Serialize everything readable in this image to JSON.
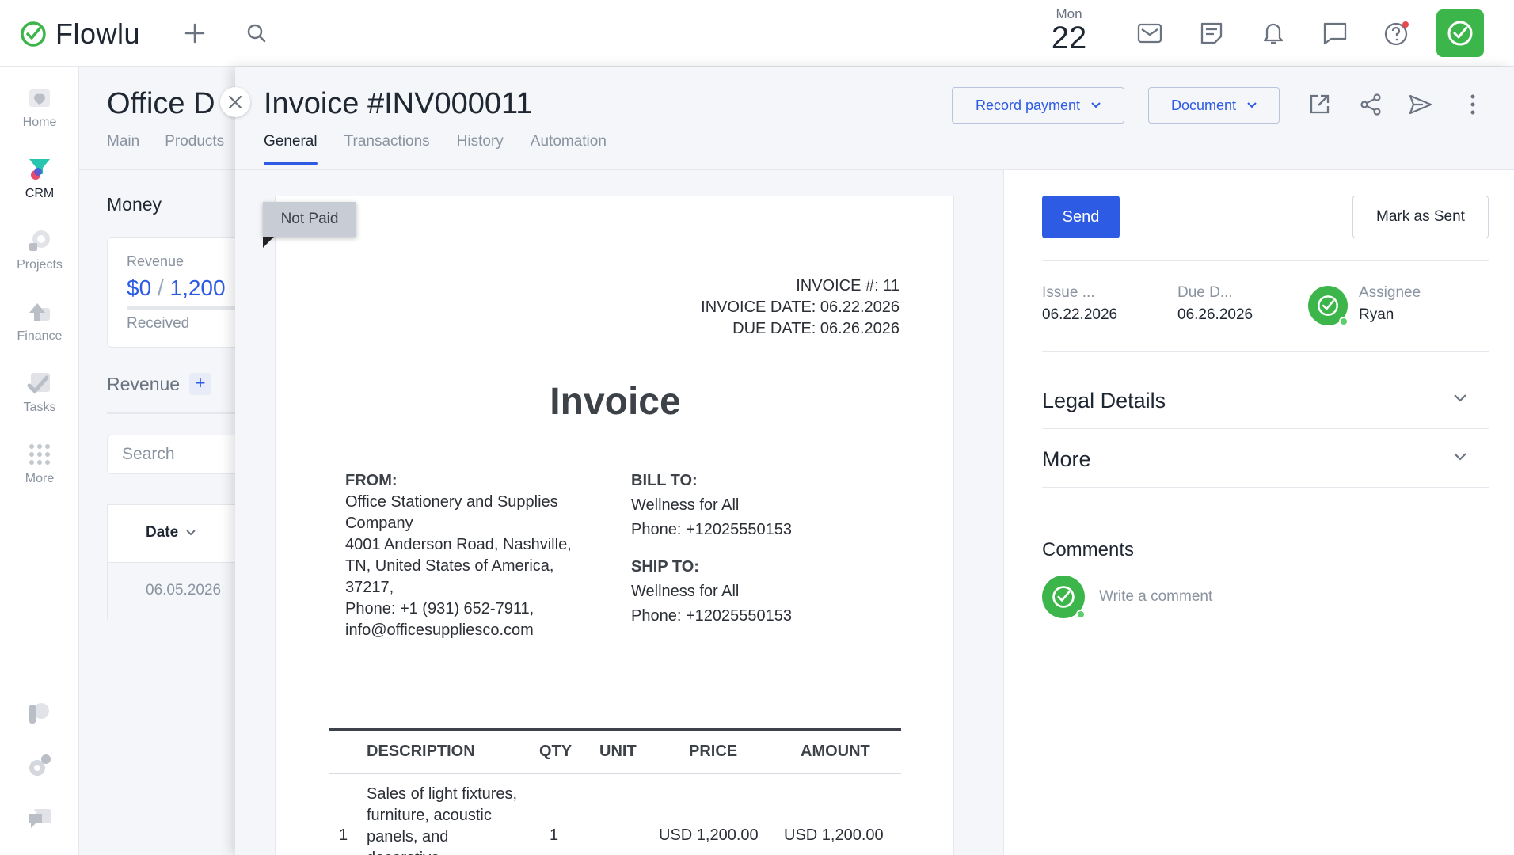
{
  "topbar": {
    "logo_text": "Flowlu",
    "date_dow": "Mon",
    "date_day": "22",
    "icons": [
      "plus-icon",
      "search-icon",
      "mail-icon",
      "notes-icon",
      "bell-icon",
      "chat-icon",
      "help-icon",
      "avatar"
    ]
  },
  "leftnav": {
    "items": [
      {
        "label": "Home",
        "icon": "home-icon"
      },
      {
        "label": "CRM",
        "icon": "crm-icon"
      },
      {
        "label": "Projects",
        "icon": "projects-icon"
      },
      {
        "label": "Finance",
        "icon": "finance-icon"
      },
      {
        "label": "Tasks",
        "icon": "tasks-icon"
      },
      {
        "label": "More",
        "icon": "grid-icon"
      }
    ]
  },
  "background": {
    "title": "Office D",
    "tabs": [
      "Main",
      "Products"
    ],
    "money_heading": "Money",
    "revenue_label": "Revenue",
    "revenue_value": "$0",
    "revenue_total": "1,200",
    "received_label": "Received",
    "revenue_section": "Revenue",
    "search_placeholder": "Search",
    "date_header": "Date",
    "date_value": "06.05.2026"
  },
  "invoice_panel": {
    "title": "Invoice #INV000011",
    "tabs": [
      "General",
      "Transactions",
      "History",
      "Automation"
    ],
    "active_tab": "General",
    "record_payment_label": "Record payment",
    "document_label": "Document"
  },
  "document": {
    "status_tag": "Not Paid",
    "invoice_no_line": "INVOICE #: 11",
    "invoice_date_line": "INVOICE DATE: 06.22.2026",
    "due_date_line": "DUE DATE: 06.26.2026",
    "heading": "Invoice",
    "from_label": "FROM:",
    "from_lines": [
      "Office Stationery and Supplies Company",
      "4001 Anderson Road, Nashville, TN, United States of America, 37217,",
      "Phone: +1 (931) 652-7911,",
      "info@officesuppliesco.com"
    ],
    "bill_to_label": "BILL TO:",
    "bill_to_name": "Wellness for All",
    "bill_to_phone": "Phone: +12025550153",
    "ship_to_label": "SHIP TO:",
    "ship_to_name": "Wellness for All",
    "ship_to_phone": "Phone: +12025550153",
    "table_headers": {
      "description": "DESCRIPTION",
      "qty": "QTY",
      "unit": "UNIT",
      "price": "PRICE",
      "amount": "AMOUNT"
    },
    "rows": [
      {
        "index": "1",
        "description": "Sales of light fixtures, furniture, acoustic panels, and decorative",
        "qty": "1",
        "unit": "",
        "price": "USD 1,200.00",
        "amount": "USD 1,200.00"
      }
    ]
  },
  "sidebar": {
    "send_label": "Send",
    "mark_sent_label": "Mark as Sent",
    "issue_label": "Issue ...",
    "issue_value": "06.22.2026",
    "due_label": "Due D...",
    "due_value": "06.26.2026",
    "assignee_label": "Assignee",
    "assignee_value": "Ryan",
    "legal_details": "Legal Details",
    "more": "More",
    "comments_heading": "Comments",
    "comment_placeholder": "Write a comment"
  },
  "colors": {
    "accent": "#2d5be3",
    "brand_green": "#3cb64a",
    "panel_bg": "#f4f6fa"
  }
}
